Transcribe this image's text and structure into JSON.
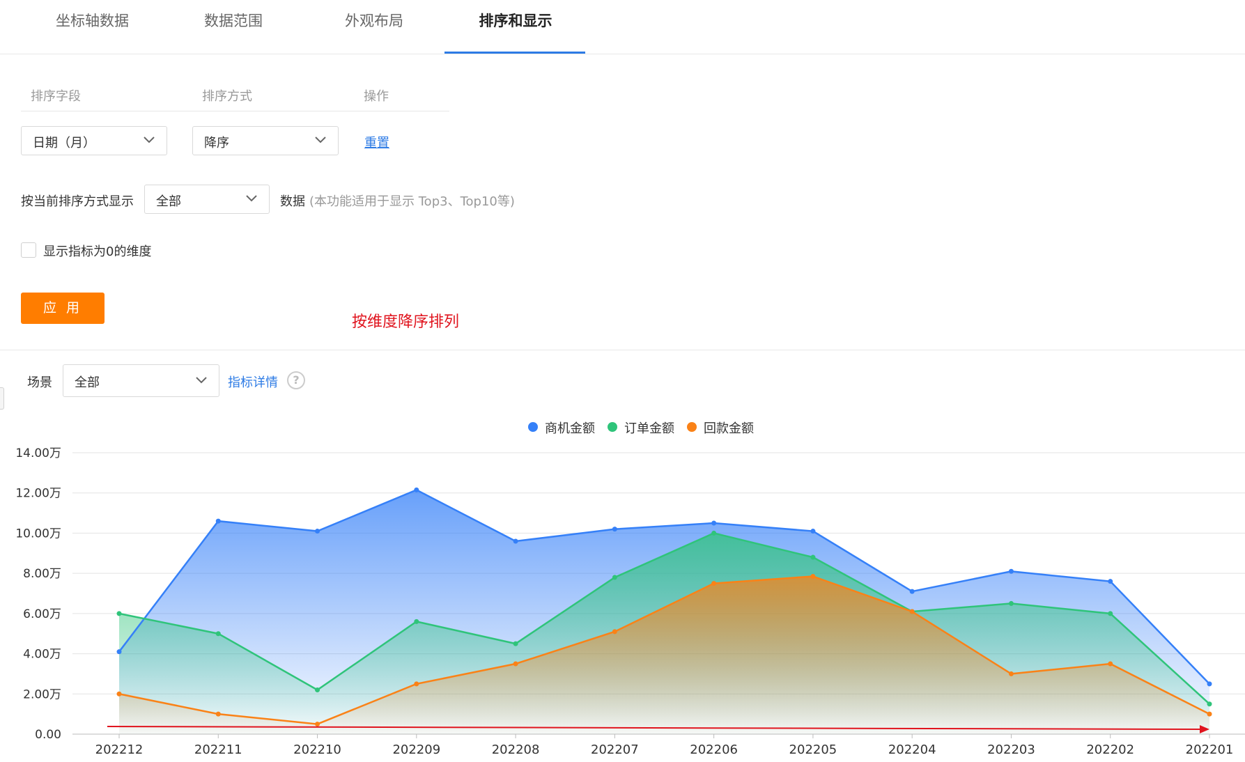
{
  "tabs": [
    "坐标轴数据",
    "数据范围",
    "外观布局",
    "排序和显示"
  ],
  "active_tab_index": 3,
  "sort_table": {
    "headers": [
      "排序字段",
      "排序方式",
      "操作"
    ],
    "field_value": "日期（月）",
    "order_value": "降序",
    "reset_label": "重置"
  },
  "display_row": {
    "prefix": "按当前排序方式显示",
    "select_value": "全部",
    "suffix": "数据",
    "hint": "(本功能适用于显示 Top3、Top10等)"
  },
  "zero_checkbox": {
    "label": "显示指标为0的维度",
    "checked": false
  },
  "apply_label": "应 用",
  "annotation": "按维度降序排列",
  "scene": {
    "label": "场景",
    "select_value": "全部",
    "detail_link": "指标详情",
    "help_icon": "question-circle-icon"
  },
  "colors": {
    "accent": "#2d7be5",
    "apply": "#ff7d00",
    "annotation": "#e0141e",
    "arrow": "#e0141e"
  },
  "chart_data": {
    "type": "area",
    "categories": [
      "202212",
      "202211",
      "202210",
      "202209",
      "202208",
      "202207",
      "202206",
      "202205",
      "202204",
      "202203",
      "202202",
      "202201"
    ],
    "series": [
      {
        "name": "商机金额",
        "color": "#3580f8",
        "values": [
          4.1,
          10.6,
          10.1,
          12.15,
          9.6,
          10.2,
          10.5,
          10.1,
          7.1,
          8.1,
          7.6,
          2.5
        ]
      },
      {
        "name": "订单金额",
        "color": "#2fc47a",
        "values": [
          6.0,
          5.0,
          2.2,
          5.6,
          4.5,
          7.8,
          10.0,
          8.8,
          6.1,
          6.5,
          6.0,
          1.5
        ]
      },
      {
        "name": "回款金额",
        "color": "#fa8217",
        "values": [
          2.0,
          1.0,
          0.5,
          2.5,
          3.5,
          5.1,
          7.5,
          7.85,
          6.1,
          3.0,
          3.5,
          1.0
        ]
      }
    ],
    "yticks": [
      "0.00",
      "2.00万",
      "4.00万",
      "6.00万",
      "8.00万",
      "10.00万",
      "12.00万",
      "14.00万"
    ],
    "ylim": [
      0,
      14
    ],
    "grid": true,
    "legend_position": "top-center",
    "arrow_color": "#e0141e"
  }
}
